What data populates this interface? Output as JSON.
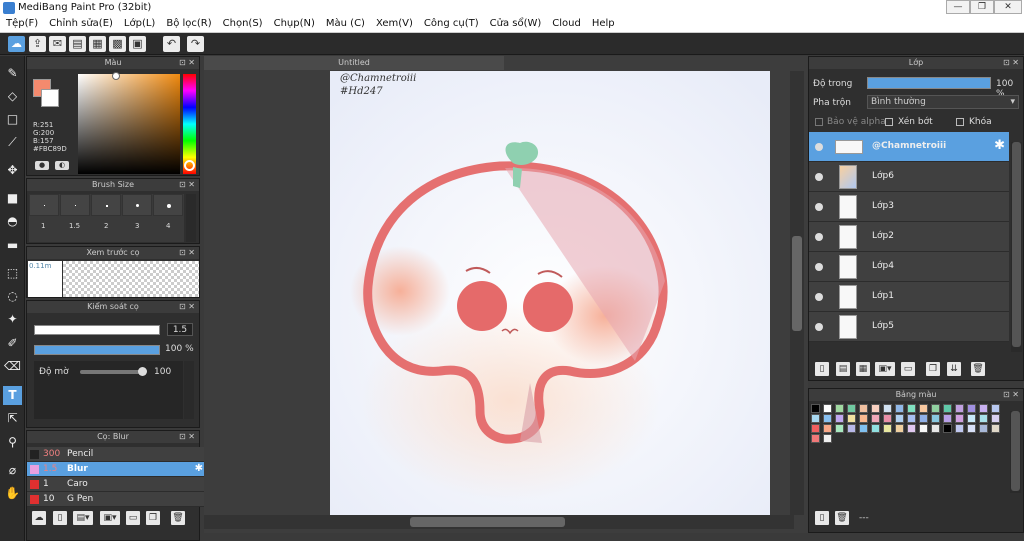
{
  "window": {
    "title": "MediBang Paint Pro (32bit)",
    "min": "—",
    "max": "❐",
    "close": "✕"
  },
  "menu": [
    "Tệp(F)",
    "Chỉnh sửa(E)",
    "Lớp(L)",
    "Bộ lọc(R)",
    "Chọn(S)",
    "Chụp(N)",
    "Màu (C)",
    "Xem(V)",
    "Công cụ(T)",
    "Cửa sổ(W)",
    "Cloud",
    "Help"
  ],
  "color_panel": {
    "title": "Màu",
    "r": "R:251",
    "g": "G:200",
    "b": "B:157",
    "hex": "#FBC89D",
    "fg": "#f48a6e",
    "bg": "#ffffff"
  },
  "brush_size": {
    "title": "Brush Size",
    "sizes": [
      "1",
      "1.5",
      "2",
      "3",
      "4"
    ]
  },
  "brush_preview": {
    "title": "Xem trước cọ",
    "value": "0.11m"
  },
  "brush_control": {
    "title": "Kiểm soát cọ",
    "size": "1.5",
    "opacity": "100",
    "opacity_unit": "%",
    "density_label": "Độ mờ",
    "density": "100"
  },
  "brush_list": {
    "title": "Cọ: Blur",
    "items": [
      {
        "size": "300",
        "name": "Pencil",
        "color": "#222222"
      },
      {
        "size": "1.5",
        "name": "Blur",
        "color": "#e8a0e0"
      },
      {
        "size": "1",
        "name": "Caro",
        "color": "#e03030"
      },
      {
        "size": "10",
        "name": "G Pen",
        "color": "#e03030"
      }
    ]
  },
  "document": {
    "tab": "Untitled",
    "text1": "@Chamnetroiii",
    "text2": "#Hd247"
  },
  "layer_panel": {
    "title": "Lớp",
    "opacity_label": "Độ trong",
    "opacity": "100",
    "opacity_unit": "%",
    "blend_label": "Pha trộn",
    "blend_value": "Bình thường",
    "protect_alpha": "Bảo vệ alpha",
    "clip": "Xén bớt",
    "lock": "Khóa",
    "layers": [
      "@Chamnetroiii",
      "Lớp6",
      "Lớp3",
      "Lớp2",
      "Lớp4",
      "Lớp1",
      "Lớp5"
    ]
  },
  "palette_panel": {
    "title": "Bảng màu",
    "footer": "---",
    "colors": [
      "#000000",
      "#ffffff",
      "#a0d8a0",
      "#70c8a0",
      "#f0c0a0",
      "#f8d0c0",
      "#d0e0f0",
      "#90b8e8",
      "#80e0c0",
      "#f8c8a0",
      "#90d0a0",
      "#60c8a8",
      "#c0a0e0",
      "#a090e0",
      "#c8b0f0",
      "#b8c8f0",
      "#a8d8f0",
      "#88c0f0",
      "#c0a8f0",
      "#f0e0a0",
      "#f8b890",
      "#f0a8b8",
      "#e890a8",
      "#b0d0f0",
      "#a8c0f0",
      "#90b0e8",
      "#88c8e0",
      "#b8a0e8",
      "#d0a0e0",
      "#c8e8f8",
      "#a8e0e8",
      "#d8d0f0",
      "#f06060",
      "#f8a888",
      "#a8e8c0",
      "#b8b8e8",
      "#80c0f0",
      "#90e0e0",
      "#e8e8a0",
      "#f0d0a0",
      "#e0c8f0",
      "#f8f8f8",
      "#e8e8e8",
      "#000000",
      "#c0c8f0",
      "#d8e0f8",
      "#a8b8d8",
      "#e0d8c8",
      "#f07878",
      "#f0f0f0"
    ]
  }
}
